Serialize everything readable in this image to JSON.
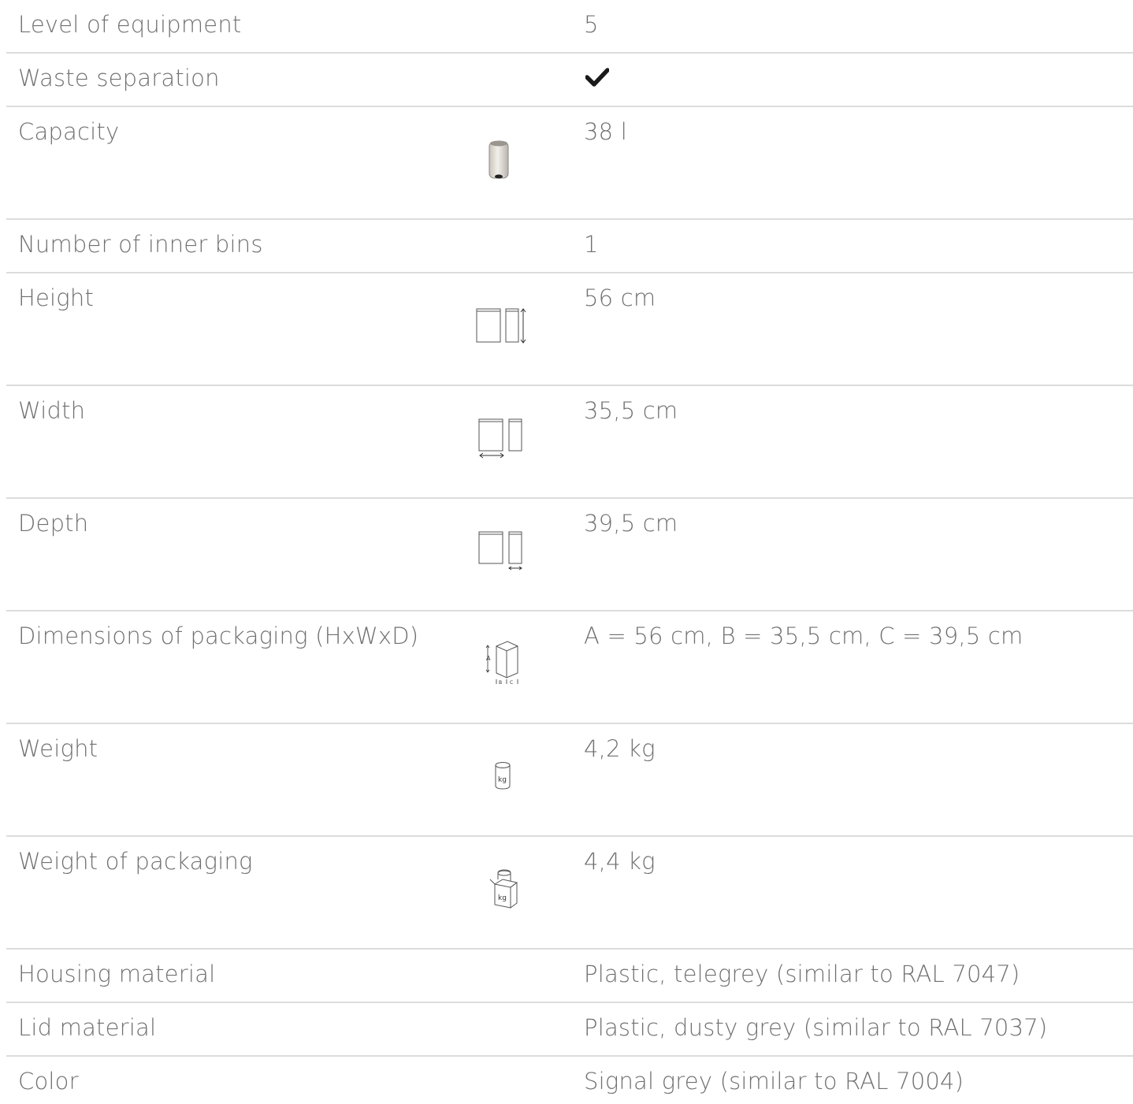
{
  "specs": {
    "rows": [
      {
        "label": "Level of equipment",
        "value": "5"
      },
      {
        "label": "Waste separation",
        "value": "",
        "icon": "checkmark-icon"
      },
      {
        "label": "Capacity",
        "value": "38 l",
        "icon": "bin-icon"
      },
      {
        "label": "Number of inner bins",
        "value": "1"
      },
      {
        "label": "Height",
        "value": "56 cm",
        "icon": "height-dimension-icon"
      },
      {
        "label": "Width",
        "value": "35,5 cm",
        "icon": "width-dimension-icon"
      },
      {
        "label": "Depth",
        "value": "39,5 cm",
        "icon": "depth-dimension-icon"
      },
      {
        "label": "Dimensions of packaging (HxWxD)",
        "value": "A = 56 cm, B = 35,5 cm, C = 39,5 cm",
        "icon": "package-dimensions-icon"
      },
      {
        "label": "Weight",
        "value": "4,2 kg",
        "icon": "weight-icon"
      },
      {
        "label": "Weight of packaging",
        "value": "4,4 kg",
        "icon": "package-weight-icon"
      },
      {
        "label": "Housing material",
        "value": "Plastic, telegrey (similar to RAL 7047)"
      },
      {
        "label": "Lid material",
        "value": "Plastic, dusty grey (similar to RAL 7037)"
      },
      {
        "label": "Color",
        "value": "Signal grey (similar to RAL 7004)"
      }
    ]
  },
  "icon_text": {
    "package_a": "A",
    "package_b": "B",
    "package_c": "C",
    "weight_unit": "kg"
  }
}
